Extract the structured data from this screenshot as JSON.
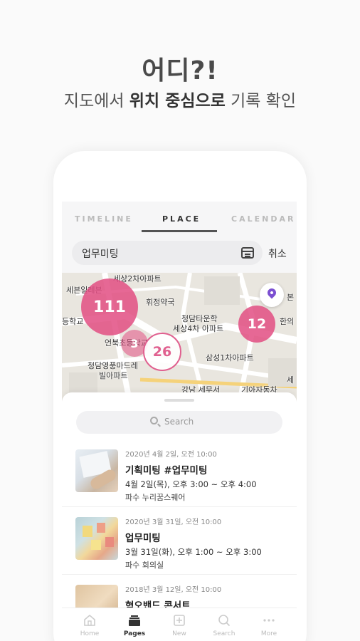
{
  "headline": "어디?!",
  "subline": {
    "pre": "지도에서 ",
    "bold": "위치 중심으로",
    "post": " 기록 확인"
  },
  "tabs": [
    {
      "label": "TIMELINE",
      "active": false
    },
    {
      "label": "PLACE",
      "active": true
    },
    {
      "label": "CALENDAR",
      "active": false
    }
  ],
  "search": {
    "query": "업무미팅",
    "cancel": "취소"
  },
  "map": {
    "labels": [
      "세상2차아파트",
      "세븐일레븐",
      "휘정약국",
      "등학교",
      "청담타운학",
      "세상4차 아파트",
      "언북초등학교",
      "청담영풍마드레",
      "빌아파트",
      "삼성1차아파트",
      "본",
      "한의",
      "세",
      "강남 세무서",
      "기아자동차"
    ],
    "clusters": [
      {
        "count": "111",
        "style": "filled"
      },
      {
        "count": "12",
        "style": "filled"
      },
      {
        "count": "3",
        "style": "filled"
      },
      {
        "count": "26",
        "style": "outline"
      }
    ],
    "accent": "#e24e82",
    "pin_color": "#7b4fd1"
  },
  "sheet": {
    "search_placeholder": "Search",
    "items": [
      {
        "meta": "2020년 4월 2일, 오전 10:00",
        "title": "기획미팅 #업무미팅",
        "time": "4월 2일(목), 오후 3:00 ~ 오후 4:00",
        "place": "파수 누리꿈스퀘어"
      },
      {
        "meta": "2020년 3월 31일, 오전 10:00",
        "title": "업무미팅",
        "time": "3월 31일(화), 오후 1:00 ~ 오후 3:00",
        "place": "파수 회의실"
      },
      {
        "meta": "2018년 3월 12일, 오전 10:00",
        "title": "혁오밴드 콘서트",
        "time": "",
        "place": ""
      }
    ]
  },
  "nav": [
    {
      "label": "Home",
      "icon": "home-icon",
      "active": false
    },
    {
      "label": "Pages",
      "icon": "pages-icon",
      "active": true
    },
    {
      "label": "New",
      "icon": "new-icon",
      "active": false
    },
    {
      "label": "Search",
      "icon": "search-icon",
      "active": false
    },
    {
      "label": "More",
      "icon": "more-icon",
      "active": false
    }
  ]
}
